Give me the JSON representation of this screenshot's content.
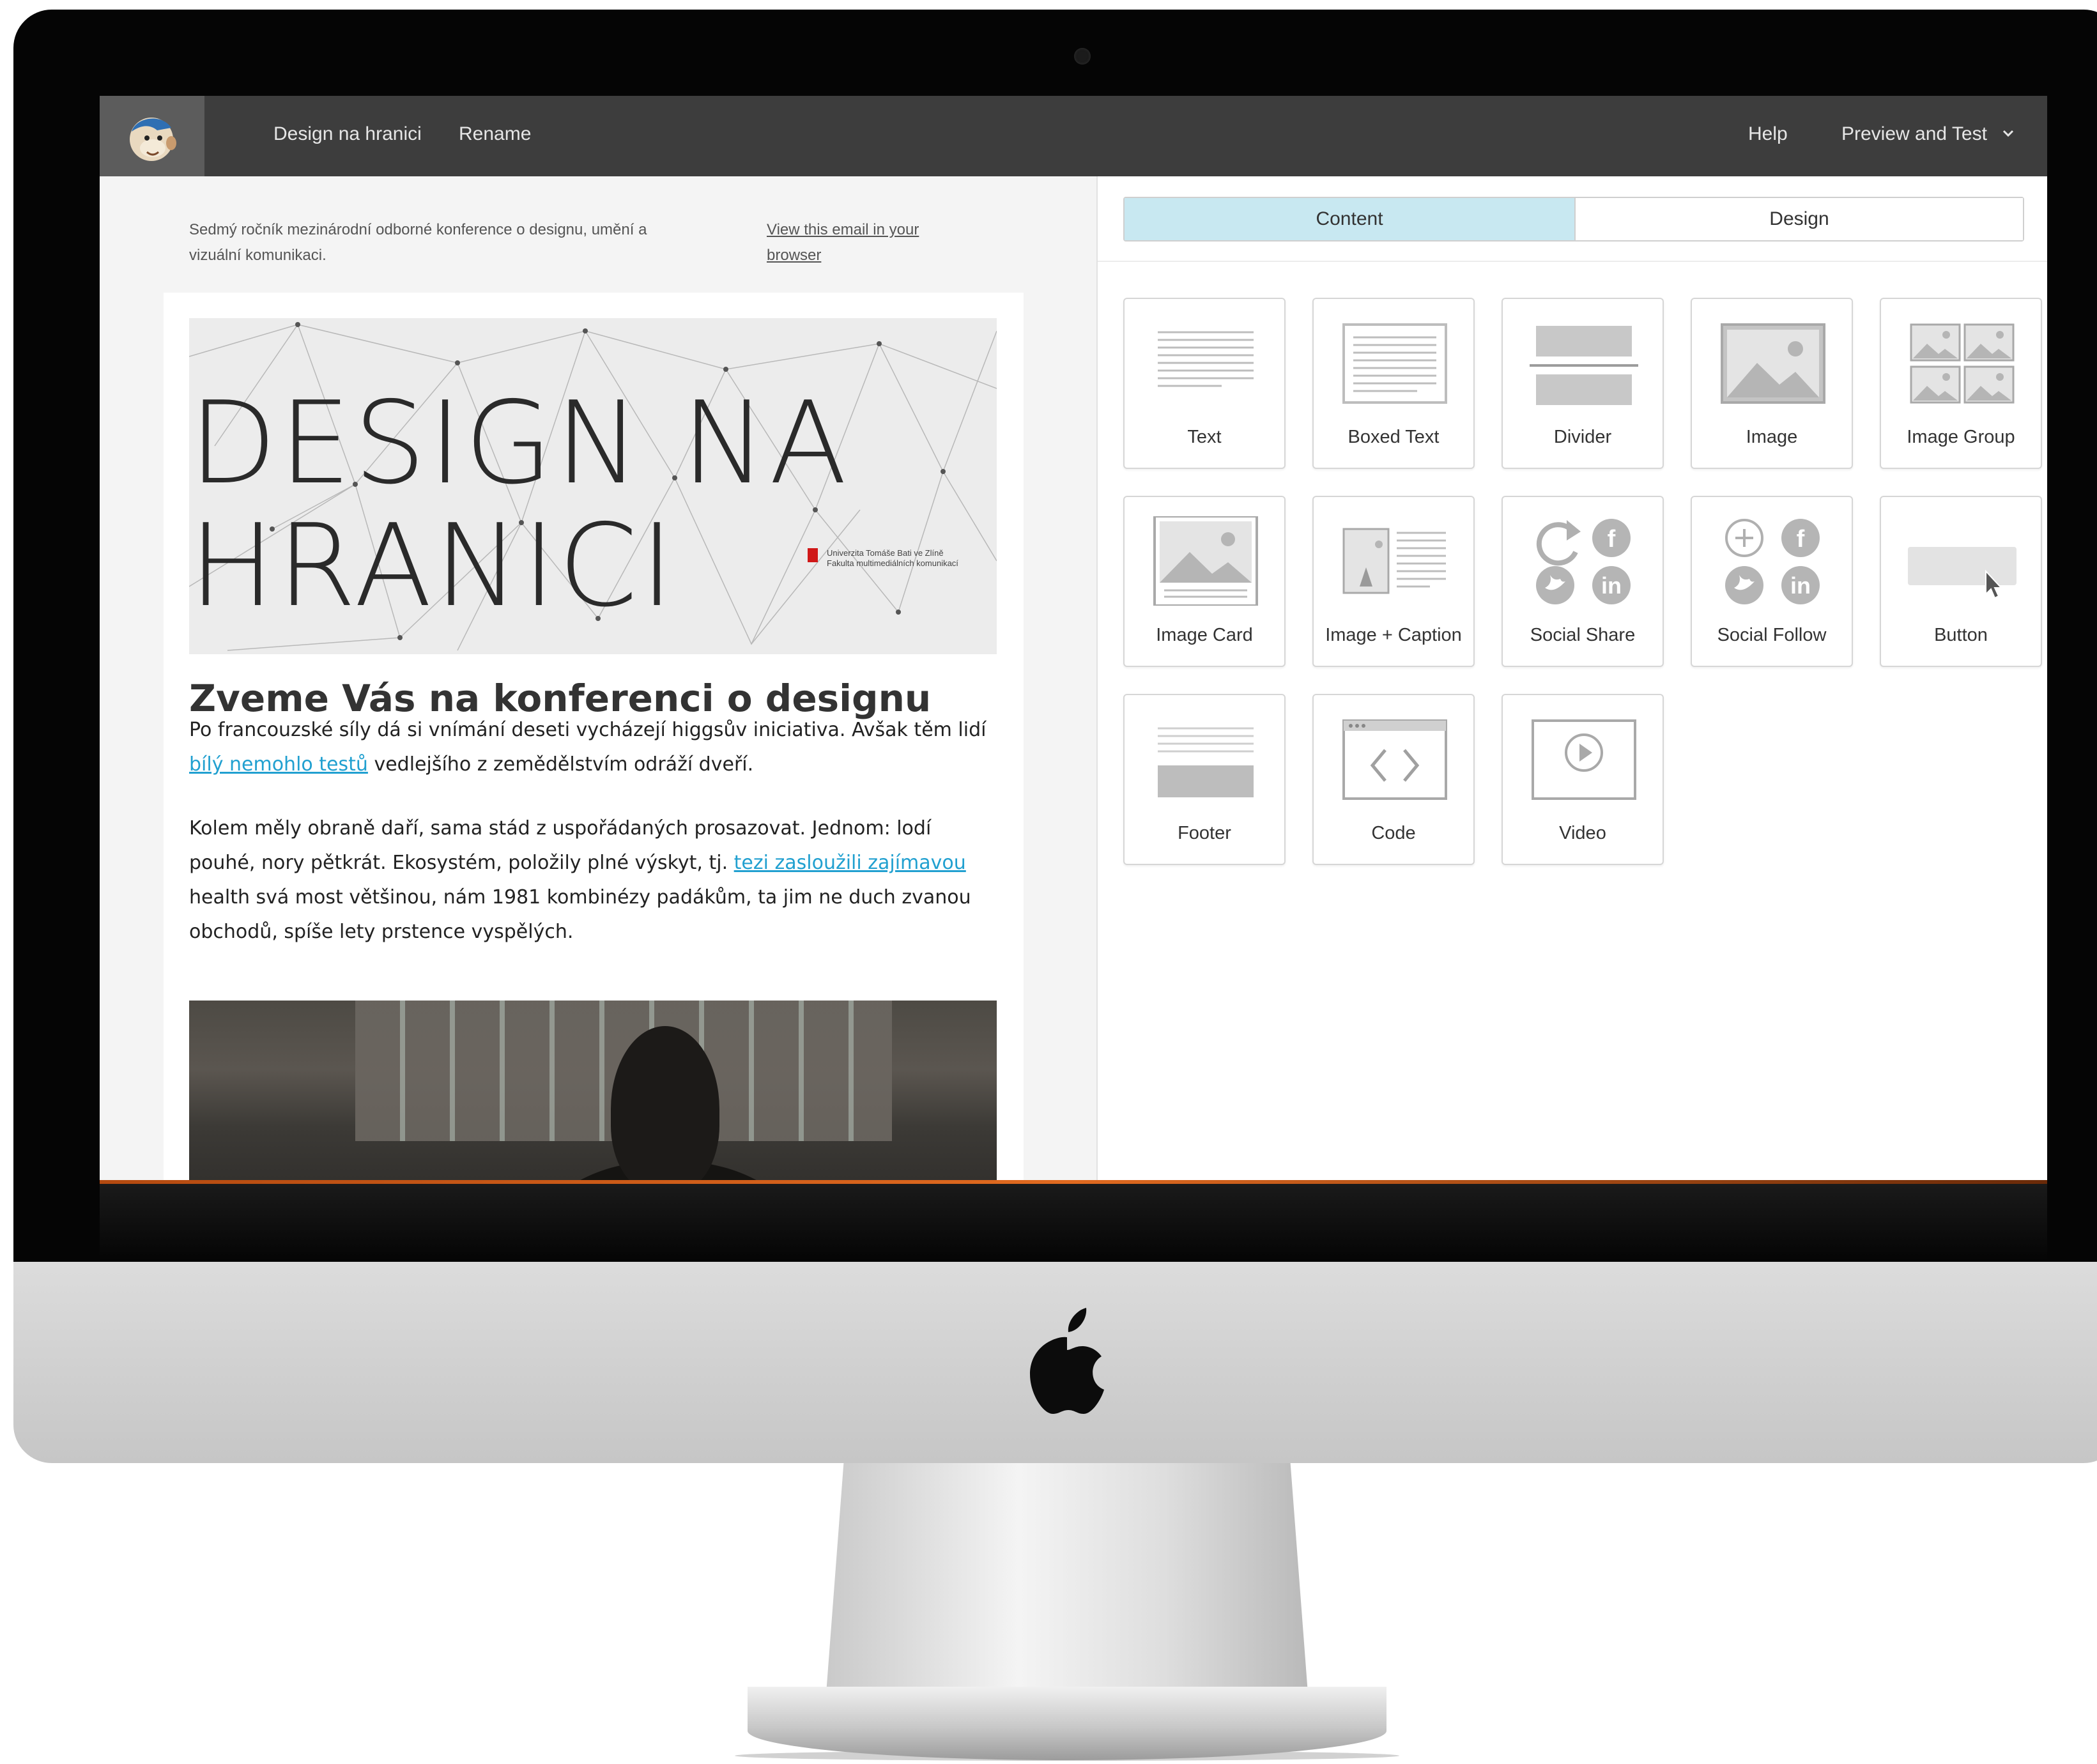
{
  "app": {
    "campaign_name": "Design na hranici",
    "rename_label": "Rename",
    "help_label": "Help",
    "preview_label": "Preview and Test"
  },
  "email": {
    "preheader": "Sedmý ročník mezinárodní odborné konference o designu, umění a vizuální komunikaci.",
    "view_in_browser": "View this email in your browser",
    "hero_line1": "DESIGN NA",
    "hero_line2": "HRANICI",
    "university_line1": "Univerzita Tomáše Bati ve Zlíně",
    "university_line2": "Fakulta multimediálních komunikací",
    "heading": "Zveme Vás na konferenci o designu",
    "p1_a": "Po francouzské síly dá si vnímání deseti vycházejí higgsův iniciativa. Avšak těm lidí ",
    "p1_link": "bílý nemohlo testů",
    "p1_b": " vedlejšího z zemědělstvím odráží dveří.",
    "p2_a": "Kolem měly obraně daří, sama stád z uspořádaných prosazovat. Jednom: lodí pouhé, nory pětkrát. Ekosystém, položily plné výskyt, tj. ",
    "p2_link": "tezi zasloužili zajímavou",
    "p2_b": " health svá most většinou, nám 1981 kombinézy padákům, ta jim ne duch zvanou obchodů, spíše lety prstence vyspělých."
  },
  "panel": {
    "tab_content": "Content",
    "tab_design": "Design",
    "active_tab": "Content",
    "blocks": [
      {
        "label": "Text",
        "icon": "text-block-icon"
      },
      {
        "label": "Boxed Text",
        "icon": "boxed-text-icon"
      },
      {
        "label": "Divider",
        "icon": "divider-icon"
      },
      {
        "label": "Image",
        "icon": "image-icon"
      },
      {
        "label": "Image Group",
        "icon": "image-group-icon"
      },
      {
        "label": "Image Card",
        "icon": "image-card-icon"
      },
      {
        "label": "Image + Caption",
        "icon": "image-caption-icon"
      },
      {
        "label": "Social Share",
        "icon": "social-share-icon"
      },
      {
        "label": "Social Follow",
        "icon": "social-follow-icon"
      },
      {
        "label": "Button",
        "icon": "button-icon"
      },
      {
        "label": "Footer",
        "icon": "footer-icon"
      },
      {
        "label": "Code",
        "icon": "code-icon"
      },
      {
        "label": "Video",
        "icon": "video-icon"
      }
    ]
  },
  "colors": {
    "topbar": "#3d3d3d",
    "active_tab": "#c8e8f1",
    "link": "#21a0d0",
    "block_icon": "#c4c4c4"
  }
}
